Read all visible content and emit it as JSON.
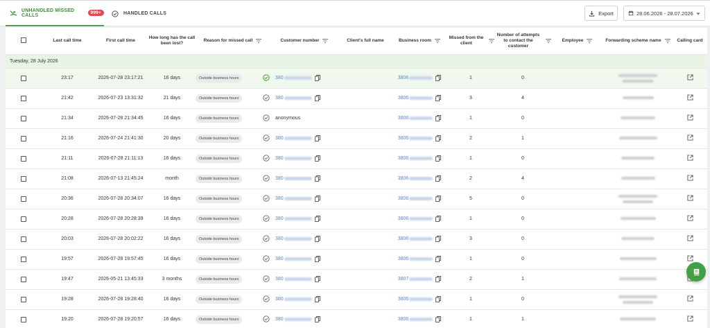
{
  "tabs": {
    "unhandled_label": "UNHANDLED MISSED CALLS",
    "unhandled_badge": "999+",
    "handled_label": "HANDLED CALLS"
  },
  "toolbar": {
    "export_label": "Export",
    "date_range": "28.06.2026 - 28.07.2026"
  },
  "columns": {
    "last_call": "Last call time",
    "first_call": "First call time",
    "lost": "How long has the call been lost?",
    "reason": "Reason for missed call",
    "customer": "Customer number",
    "client_name": "Client's full name",
    "business_room": "Business room",
    "missed_from": "Missed from the client",
    "attempts": "Number of attempts to contact the customer",
    "employee": "Employee",
    "forwarding": "Forwarding scheme name",
    "calling_card": "Calling card"
  },
  "group_label": "Tuesday, 28 July 2026",
  "rows": [
    {
      "last": "23:17",
      "first": "2026-07-28 23:17:21",
      "lost": "16 days",
      "reason": "Outside business hours",
      "cust_prefix": "380",
      "room_prefix": "3806",
      "missed": "1",
      "attempts": "0"
    },
    {
      "last": "21:42",
      "first": "2026-07-23 13:31:32",
      "lost": "21 days",
      "reason": "Outside business hours",
      "cust_prefix": "380",
      "room_prefix": "3806",
      "missed": "3",
      "attempts": "4"
    },
    {
      "last": "21:34",
      "first": "2026-07-28 21:34:45",
      "lost": "16 days",
      "reason": "Outside business hours",
      "cust_text": "anonymous",
      "room_prefix": "3806",
      "missed": "1",
      "attempts": "0"
    },
    {
      "last": "21:16",
      "first": "2026-07-24 21:41:30",
      "lost": "20 days",
      "reason": "Outside business hours",
      "cust_prefix": "380",
      "room_prefix": "3806",
      "missed": "2",
      "attempts": "1"
    },
    {
      "last": "21:11",
      "first": "2026-07-28 21:11:13",
      "lost": "16 days",
      "reason": "Outside business hours",
      "cust_prefix": "380",
      "room_prefix": "3806",
      "missed": "1",
      "attempts": "0"
    },
    {
      "last": "21:08",
      "first": "2026-07-13 21:45:24",
      "lost": "month",
      "reason": "Outside business hours",
      "cust_prefix": "380",
      "room_prefix": "3806",
      "missed": "2",
      "attempts": "4"
    },
    {
      "last": "20:36",
      "first": "2026-07-28 20:34:07",
      "lost": "16 days",
      "reason": "Outside business hours",
      "cust_prefix": "380",
      "room_prefix": "3806",
      "missed": "5",
      "attempts": "0"
    },
    {
      "last": "20:28",
      "first": "2026-07-28 20:28:39",
      "lost": "16 days",
      "reason": "Outside business hours",
      "cust_prefix": "380",
      "room_prefix": "3806",
      "missed": "1",
      "attempts": "0"
    },
    {
      "last": "20:03",
      "first": "2026-07-28 20:02:22",
      "lost": "16 days",
      "reason": "Outside business hours",
      "cust_prefix": "380",
      "room_prefix": "3806",
      "missed": "3",
      "attempts": "0"
    },
    {
      "last": "19:57",
      "first": "2026-07-28 19:57:45",
      "lost": "16 days",
      "reason": "Outside business hours",
      "cust_prefix": "380",
      "room_prefix": "3806",
      "missed": "1",
      "attempts": "0"
    },
    {
      "last": "19:47",
      "first": "2026-05-21 13:45:33",
      "lost": "3 months",
      "reason": "Outside business hours",
      "cust_prefix": "380",
      "room_prefix": "3807",
      "missed": "2",
      "attempts": "1"
    },
    {
      "last": "19:28",
      "first": "2026-07-28 19:28:40",
      "lost": "16 days",
      "reason": "Outside business hours",
      "cust_prefix": "380",
      "room_prefix": "3806",
      "missed": "1",
      "attempts": "0"
    },
    {
      "last": "19:20",
      "first": "2026-07-28 19:20:57",
      "lost": "16 days",
      "reason": "Outside business hours",
      "cust_prefix": "380",
      "room_prefix": "3806",
      "missed": "1",
      "attempts": "1"
    }
  ]
}
